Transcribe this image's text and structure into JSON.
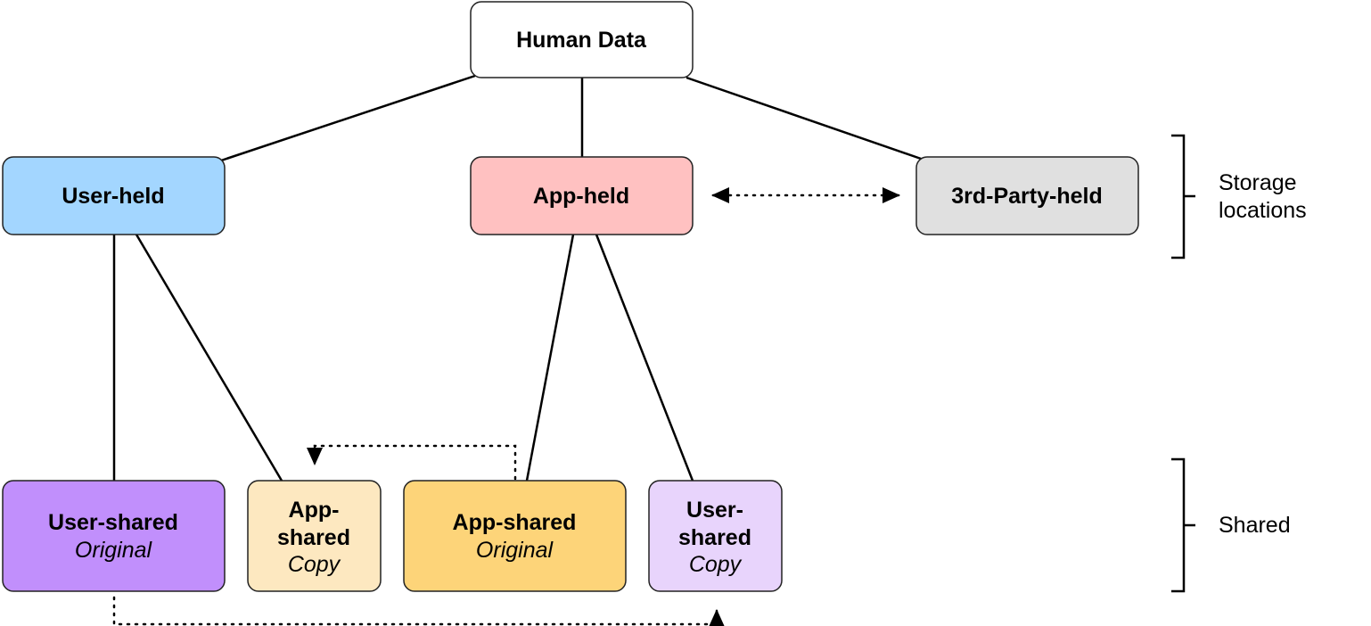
{
  "colors": {
    "human_data": "#ffffff",
    "user_held": "#a3d6ff",
    "app_held": "#ffc1c1",
    "third_party_held": "#e0e0e0",
    "user_shared_original": "#c18ffc",
    "app_shared_copy": "#fde8c0",
    "app_shared_original": "#fdd479",
    "user_shared_copy": "#e8d4fc"
  },
  "nodes": {
    "human_data": "Human Data",
    "user_held": "User-held",
    "app_held": "App-held",
    "third_party_held": "3rd-Party-held",
    "user_shared_original": {
      "line1": "User-shared",
      "line2": "Original"
    },
    "app_shared_copy": {
      "line1": "App-",
      "line2": "shared",
      "line3": "Copy"
    },
    "app_shared_original": {
      "line1": "App-shared",
      "line2": "Original"
    },
    "user_shared_copy": {
      "line1": "User-",
      "line2": "shared",
      "line3": "Copy"
    }
  },
  "groups": {
    "storage": {
      "line1": "Storage",
      "line2": "locations"
    },
    "shared": "Shared"
  }
}
